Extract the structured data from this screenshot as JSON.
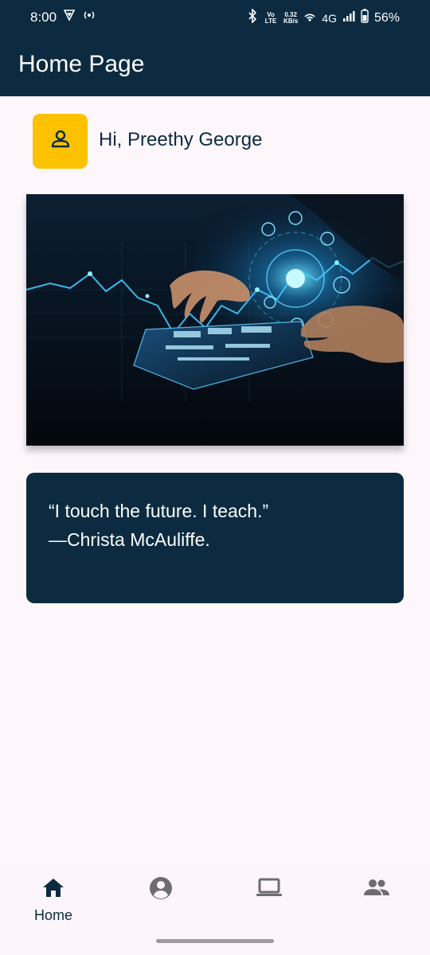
{
  "status_bar": {
    "time": "8:00",
    "lte_label": "Vo LTE",
    "net_speed_value": "0.32",
    "net_speed_unit": "KB/s",
    "network": "4G",
    "battery": "56%",
    "icons": [
      "vpn-icon",
      "hotspot-icon",
      "bluetooth-icon",
      "wifi-icon",
      "signal-icon",
      "battery-icon"
    ]
  },
  "app_bar": {
    "title": "Home Page"
  },
  "user": {
    "greeting": "Hi, Preethy George",
    "avatar_icon": "person-icon"
  },
  "hero": {
    "image_icon": "digital-technology-image"
  },
  "quote": {
    "line1": "“I touch the future. I teach.”",
    "line2": "—Christa McAuliffe."
  },
  "bottom_nav": {
    "items": [
      {
        "label": "Home",
        "icon": "home-icon",
        "active": true
      },
      {
        "label": "",
        "icon": "account-icon",
        "active": false
      },
      {
        "label": "",
        "icon": "laptop-icon",
        "active": false
      },
      {
        "label": "",
        "icon": "people-icon",
        "active": false
      }
    ]
  },
  "colors": {
    "primary": "#0c2b40",
    "accent": "#fcc200",
    "background": "#fdf7fc",
    "inactive_icon": "#6d6c71"
  }
}
